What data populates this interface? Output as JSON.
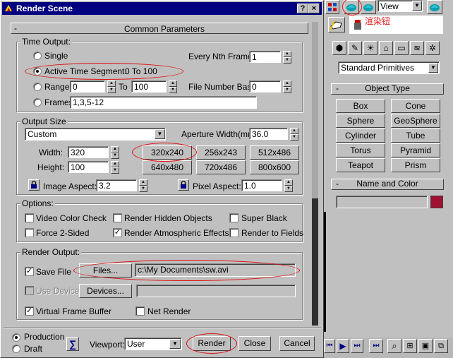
{
  "dialog": {
    "title": "Render Scene",
    "help_btn": "?",
    "close_btn": "×",
    "section_title": "Common Parameters",
    "time_output": {
      "label": "Time Output:",
      "single": "Single",
      "every_nth_label": "Every Nth Frame:",
      "every_nth_value": "1",
      "active_segment": "Active Time Segment:",
      "active_range": "0 To 100",
      "range_label": "Range:",
      "range_from": "0",
      "range_to_label": "To",
      "range_to": "100",
      "file_number_label": "File Number Base:",
      "file_number_value": "0",
      "frames_label": "Frames",
      "frames_value": "1,3,5-12"
    },
    "output_size": {
      "label": "Output Size",
      "preset": "Custom",
      "aperture_label": "Aperture Width(mm):",
      "aperture_value": "36.0",
      "width_label": "Width:",
      "width_value": "320",
      "height_label": "Height:",
      "height_value": "100",
      "presets": [
        "320x240",
        "256x243",
        "512x486",
        "640x480",
        "720x486",
        "800x600"
      ],
      "image_aspect_label": "Image Aspect:",
      "image_aspect_value": "3.2",
      "pixel_aspect_label": "Pixel Aspect:",
      "pixel_aspect_value": "1.0"
    },
    "options": {
      "label": "Options:",
      "video_color_check": "Video Color Check",
      "render_hidden": "Render Hidden Objects",
      "super_black": "Super Black",
      "force_2sided": "Force 2-Sided",
      "render_atmospheric": "Render Atmospheric Effects",
      "render_to_fields": "Render to Fields"
    },
    "render_output": {
      "label": "Render Output:",
      "save_file": "Save File",
      "files_button": "Files...",
      "file_path": "c:\\My Documents\\sw.avi",
      "use_device": "Use Device",
      "devices_button": "Devices...",
      "virtual_frame_buffer": "Virtual Frame Buffer",
      "net_render": "Net Render"
    },
    "bottom": {
      "production": "Production",
      "draft": "Draft",
      "viewport_label": "Viewport:",
      "viewport_value": "User",
      "render_button": "Render",
      "close_button": "Close",
      "cancel_button": "Cancel"
    }
  },
  "right_panel": {
    "view_dropdown": "View",
    "annotation": "渲染钮",
    "primitives_dropdown": "Standard Primitives",
    "object_type_label": "Object Type",
    "object_buttons": [
      "Box",
      "Cone",
      "Sphere",
      "GeoSphere",
      "Cylinder",
      "Tube",
      "Torus",
      "Pyramid",
      "Teapot",
      "Prism"
    ],
    "name_color_label": "Name and Color",
    "swatch_color": "#a01030"
  },
  "colors": {
    "title_bar": "#000080",
    "highlight": "#e01010"
  }
}
